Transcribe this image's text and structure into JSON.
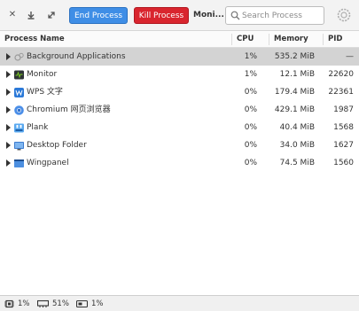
{
  "toolbar": {
    "end_process_label": "End Process",
    "kill_process_label": "Kill Process",
    "view_label": "Moni...",
    "search_placeholder": "Search Process"
  },
  "columns": {
    "name": "Process Name",
    "cpu": "CPU",
    "memory": "Memory",
    "pid": "PID"
  },
  "processes": [
    {
      "name": "Background Applications",
      "cpu": "1%",
      "memory": "535.2 MiB",
      "pid": "—",
      "icon": "background-apps-icon"
    },
    {
      "name": "Monitor",
      "cpu": "1%",
      "memory": "12.1 MiB",
      "pid": "22620",
      "icon": "monitor-app-icon"
    },
    {
      "name": "WPS 文字",
      "cpu": "0%",
      "memory": "179.4 MiB",
      "pid": "22361",
      "icon": "wps-writer-icon"
    },
    {
      "name": "Chromium 网页浏览器",
      "cpu": "0%",
      "memory": "429.1 MiB",
      "pid": "1987",
      "icon": "chromium-icon"
    },
    {
      "name": "Plank",
      "cpu": "0%",
      "memory": "40.4 MiB",
      "pid": "1568",
      "icon": "plank-icon"
    },
    {
      "name": "Desktop Folder",
      "cpu": "0%",
      "memory": "34.0 MiB",
      "pid": "1627",
      "icon": "desktop-folder-icon"
    },
    {
      "name": "Wingpanel",
      "cpu": "0%",
      "memory": "74.5 MiB",
      "pid": "1560",
      "icon": "wingpanel-icon"
    }
  ],
  "footer": {
    "cpu": "1%",
    "memory": "51%",
    "swap": "1%"
  },
  "colors": {
    "end_process": "#3f8ee6",
    "kill_process": "#d9252e",
    "selected_row": "#d3d3d3"
  }
}
